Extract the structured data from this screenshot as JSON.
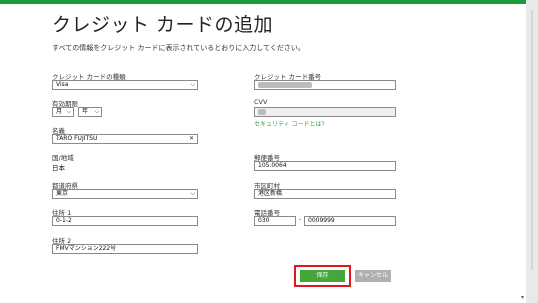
{
  "page": {
    "title": "クレジット カードの追加",
    "subtitle": "すべての情報をクレジット カードに表示されているとおりに入力してください。"
  },
  "form": {
    "card_type": {
      "label": "クレジット カードの種類",
      "value": "Visa"
    },
    "card_number": {
      "label": "クレジット カード番号"
    },
    "expiry": {
      "label": "有効期限",
      "month_value": "月",
      "year_value": "年"
    },
    "cvv": {
      "label": "CVV",
      "help_link": "セキュリティ コードとは?"
    },
    "name": {
      "label": "名義",
      "value": "TARO FUJITSU"
    },
    "country": {
      "label": "国/地域",
      "value": "日本"
    },
    "postal_code": {
      "label": "郵便番号",
      "value": "105.0064"
    },
    "prefecture": {
      "label": "都道府県",
      "value": "東京"
    },
    "city": {
      "label": "市区町村",
      "value": "港区新橋"
    },
    "address1": {
      "label": "住所 1",
      "value": "0-1-2"
    },
    "phone": {
      "label": "電話番号",
      "area_value": "030",
      "number_value": "0009999"
    },
    "address2": {
      "label": "住所 2",
      "value": "FMVマンション222号"
    }
  },
  "actions": {
    "save_label": "保存",
    "cancel_label": "キャンセル"
  },
  "colors": {
    "accent_green": "#45a63a",
    "highlight_red": "#e0181e",
    "top_bar": "#1a9a3a"
  }
}
